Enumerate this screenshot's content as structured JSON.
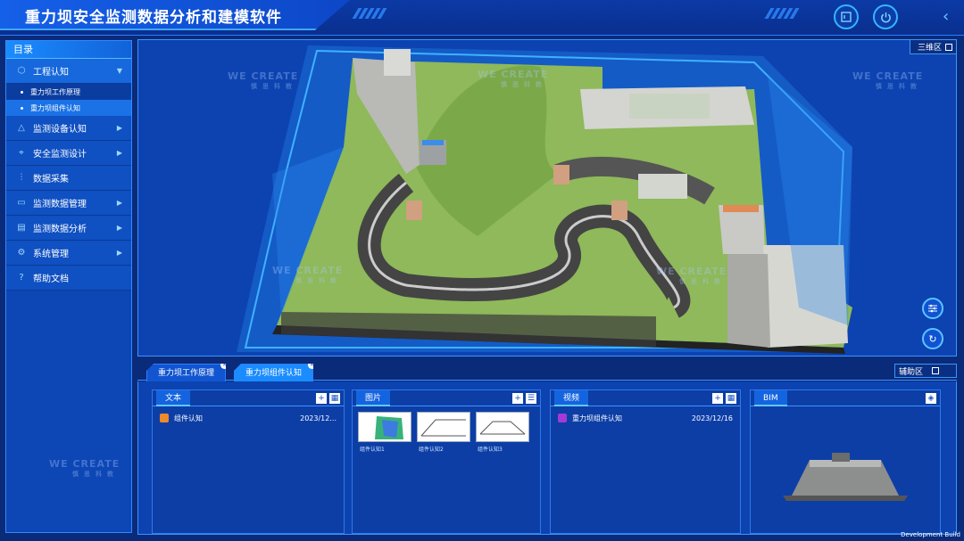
{
  "header": {
    "title": "重力坝安全监测数据分析和建模软件",
    "buttons": [
      "menu-button",
      "power-button"
    ]
  },
  "sidebar": {
    "title": "目录",
    "items": [
      {
        "label": "工程认知",
        "icon": "cube-icon",
        "expanded": true,
        "children": [
          "重力坝工作原理",
          "重力坝组件认知"
        ]
      },
      {
        "label": "监测设备认知",
        "icon": "warning-triangle-icon"
      },
      {
        "label": "安全监测设计",
        "icon": "vector-icon"
      },
      {
        "label": "数据采集",
        "icon": "sliders-icon"
      },
      {
        "label": "监测数据管理",
        "icon": "monitor-icon"
      },
      {
        "label": "监测数据分析",
        "icon": "chart-icon"
      },
      {
        "label": "系统管理",
        "icon": "gear-icon"
      },
      {
        "label": "帮助文档",
        "icon": "help-icon"
      }
    ],
    "active_child": "重力坝组件认知"
  },
  "view3d": {
    "label": "三维区",
    "watermark_main": "WE CREATE",
    "watermark_sub": "慎思科教"
  },
  "tabs": [
    {
      "label": "重力坝工作原理",
      "active": false
    },
    {
      "label": "重力坝组件认知",
      "active": true
    }
  ],
  "aux_label": "辅助区",
  "cards": {
    "text": {
      "title": "文本",
      "file": "组件认知",
      "date": "2023/12..."
    },
    "image": {
      "title": "图片",
      "captions": [
        "组件认知1",
        "组件认知2",
        "组件认知3"
      ]
    },
    "video": {
      "title": "视频",
      "file": "重力坝组件认知",
      "date": "2023/12/16"
    },
    "bim": {
      "title": "BIM"
    }
  },
  "footer": {
    "build": "Development Build"
  },
  "colors": {
    "accent": "#1a8cff",
    "panel": "#0c43b0",
    "border": "#3a96ff"
  }
}
